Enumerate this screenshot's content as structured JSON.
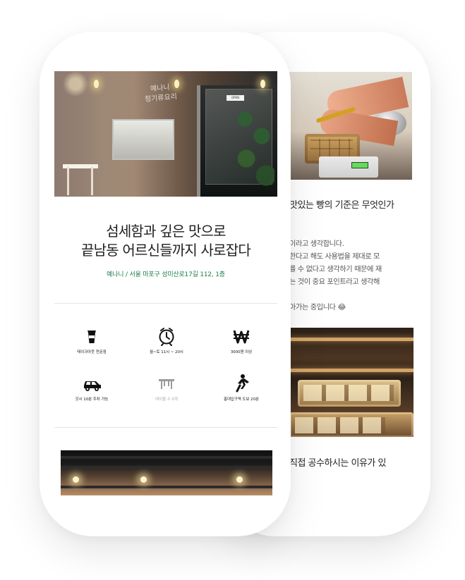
{
  "front": {
    "title": "섬세함과 깊은 맛으로\n끝남동 어르신들까지 사로잡다",
    "address": "예나니 / 서울 마포구 성미산로17길 112, 1층",
    "amenities": [
      {
        "label": "테이크아웃 전문점",
        "icon": "coffee-cup-icon",
        "muted": false
      },
      {
        "label": "월~토 11시 ~ 20시",
        "icon": "alarm-clock-icon",
        "muted": false
      },
      {
        "label": "3000원 이상",
        "icon": "won-currency-icon",
        "muted": false
      },
      {
        "label": "갓시 10분 주차 가능",
        "icon": "car-icon",
        "muted": false
      },
      {
        "label": "테이블 수 0개",
        "icon": "table-icon",
        "muted": true
      },
      {
        "label": "홍대입구역 도보 20분",
        "icon": "walking-person-icon",
        "muted": false
      }
    ]
  },
  "back": {
    "heading_top": "맛있는 빵의 기준은 무엇인가",
    "body": "이라고 생각합니다.\n한다고 해도 사용법을 제대로 모\n를 수 없다고 생각하기 때문에 재\n는 것이 중요 포인트라고 생각해\n\n아가는 중입니다 😂",
    "heading_bottom": "직접 공수하시는 이유가 있"
  },
  "hero_photo": {
    "logo_text": "예나니\n청기류요리",
    "sign_text": "OPEN"
  }
}
